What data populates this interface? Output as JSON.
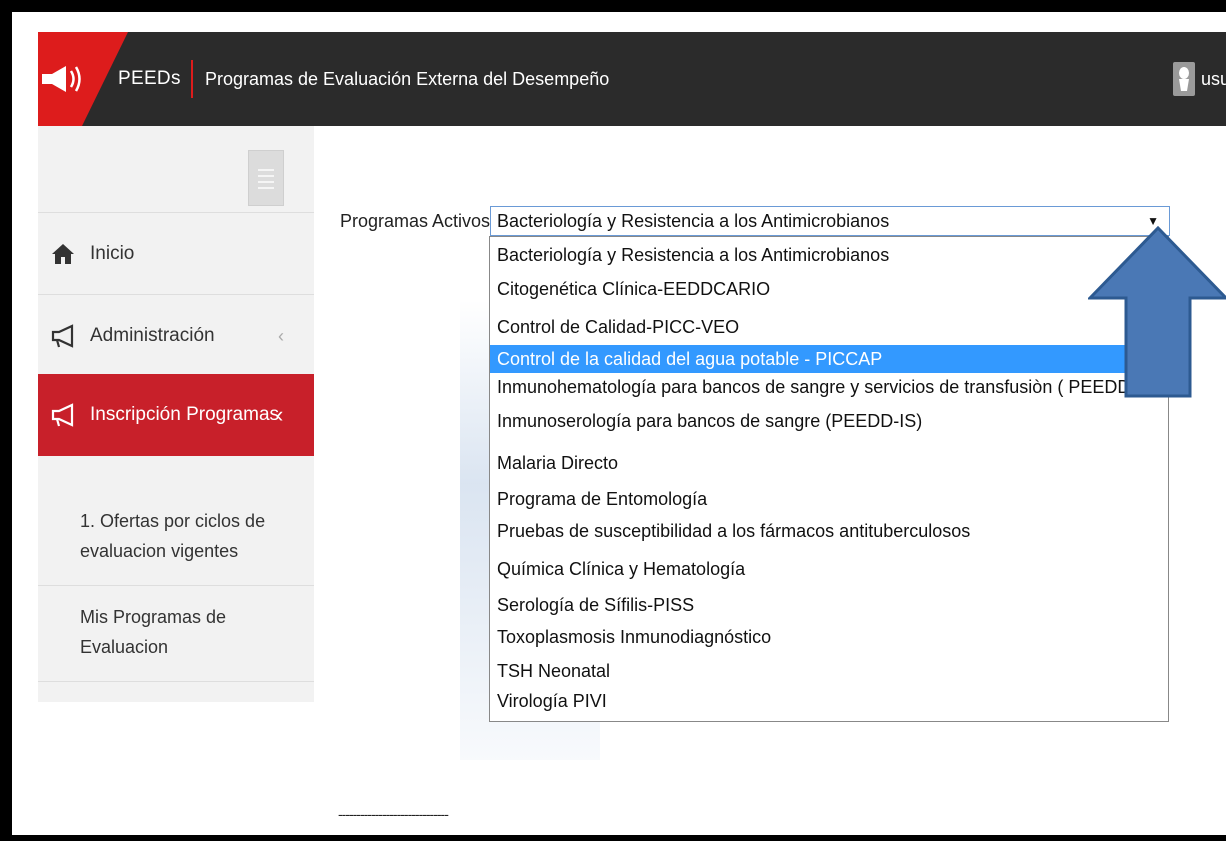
{
  "header": {
    "app_short": "PEEDs",
    "app_long": "Programas de Evaluación Externa del Desempeño",
    "user_label": "usua",
    "brand_color": "#dd1c1c",
    "bar_color": "#2b2b2b"
  },
  "sidebar": {
    "menu_toggle_icon": "hamburger-icon",
    "items": [
      {
        "label": "Inicio",
        "icon": "home-icon"
      },
      {
        "label": "Administración",
        "icon": "megaphone-icon",
        "chevron": "‹"
      },
      {
        "label": "Inscripción Programas",
        "icon": "megaphone-icon",
        "chevron": "‹",
        "active": true
      }
    ],
    "submenu": [
      {
        "line1": "1. Ofertas por ciclos de",
        "line2": "evaluacion vigentes"
      },
      {
        "line1": "Mis Programas de",
        "line2": "Evaluacion"
      }
    ],
    "active_color": "#c8202a"
  },
  "main": {
    "select_label": "Programas Activos",
    "selected_value": "Bacteriología y Resistencia a los Antimicrobianos",
    "options": [
      "Bacteriología y Resistencia a los Antimicrobianos",
      "Citogenética Clínica-EEDDCARIO",
      "Control de Calidad-PICC-VEO",
      "Control de la calidad del agua potable - PICCAP",
      "Inmunohematología para bancos de sangre y servicios de transfusiòn ( PEEDD- IH)",
      "Inmunoserología para bancos de sangre (PEEDD-IS)",
      "Malaria Directo",
      "Programa de Entomología",
      "Pruebas de susceptibilidad a los fármacos antituberculosos",
      "Química Clínica y Hematología",
      "Serología de Sífilis-PISS",
      "Toxoplasmosis Inmunodiagnóstico",
      "TSH Neonatal",
      "Virología PIVI"
    ],
    "highlighted_option": "Control de la calidad del agua potable - PICCAP",
    "dashes": "------------------------------"
  },
  "annotation": {
    "arrow_color": "#4a78b5",
    "arrow_icon": "up-arrow-callout"
  }
}
